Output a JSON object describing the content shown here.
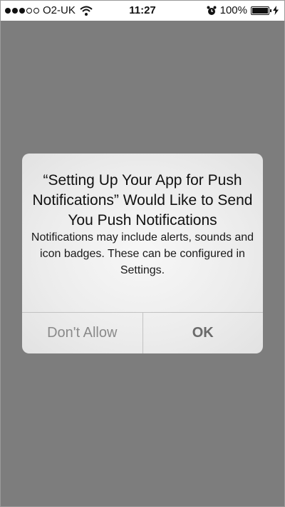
{
  "status_bar": {
    "signal_bars_filled": 3,
    "signal_bars_total": 5,
    "carrier": "O2-UK",
    "wifi_icon": "wifi-icon",
    "time": "11:27",
    "alarm_icon": "alarm-clock-icon",
    "battery_percent": "100%",
    "battery_level": 1.0,
    "charging_icon": "charging-bolt-icon"
  },
  "alert": {
    "title": "“Setting Up Your App for Push Notifications” Would Like to Send You Push Notifications",
    "message": "Notifications may include alerts, sounds and icon badges. These can be configured in Settings.",
    "deny_label": "Don't Allow",
    "ok_label": "OK"
  },
  "colors": {
    "overlay": "#7d7d7d",
    "alert_background": "#efefef",
    "deny_text": "#8a8a8a",
    "ok_text": "#6a6a6a"
  }
}
